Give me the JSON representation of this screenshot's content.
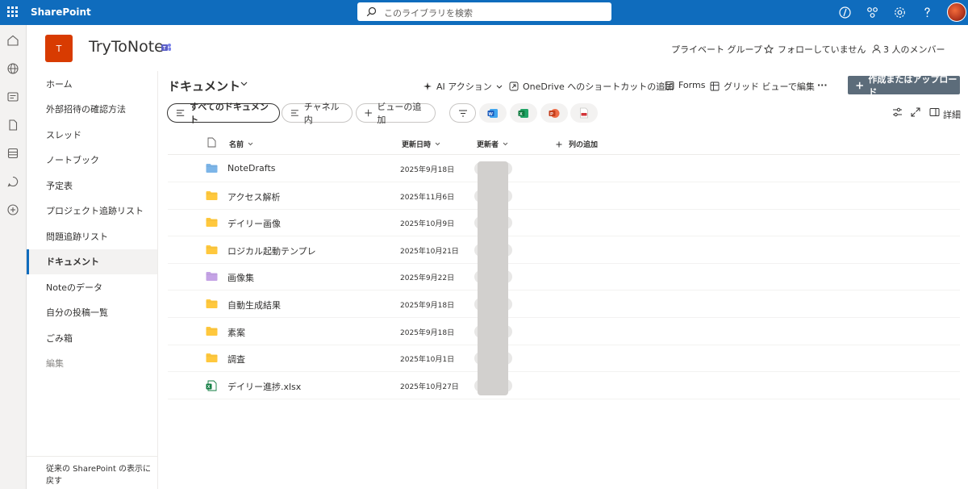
{
  "suite": {
    "app_name": "SharePoint",
    "search_placeholder": "このライブラリを検索"
  },
  "site": {
    "logo_letter": "T",
    "title": "TryToNote",
    "privacy": "プライベート グループ",
    "follow": "フォローしていません",
    "members": "3 人のメンバー"
  },
  "nav": {
    "items": [
      {
        "label": "ホーム"
      },
      {
        "label": "外部招待の確認方法"
      },
      {
        "label": "スレッド"
      },
      {
        "label": "ノートブック"
      },
      {
        "label": "予定表"
      },
      {
        "label": "プロジェクト追跡リスト"
      },
      {
        "label": "問題追跡リスト"
      },
      {
        "label": "ドキュメント"
      },
      {
        "label": "Noteのデータ"
      },
      {
        "label": "自分の投稿一覧"
      },
      {
        "label": "ごみ箱"
      },
      {
        "label": "編集"
      }
    ],
    "footer": "従来の SharePoint の表示に戻す"
  },
  "library": {
    "title": "ドキュメント",
    "commands": {
      "ai": "AI アクション",
      "shortcut": "OneDrive へのショートカットの追加",
      "forms": "Forms",
      "grid": "グリッド ビューで編集",
      "more": "···",
      "create": "作成またはアップロード"
    },
    "views": {
      "all": "すべてのドキュメント",
      "channel": "チャネル内",
      "add_view": "ビューの追加"
    },
    "details": "詳細"
  },
  "grid": {
    "columns": {
      "name": "名前",
      "modified": "更新日時",
      "modified_by": "更新者",
      "add_column": "列の追加"
    },
    "rows": [
      {
        "name": "NoteDrafts",
        "date": "2025年9月18日",
        "type": "folder-blue"
      },
      {
        "name": "アクセス解析",
        "date": "2025年11月6日",
        "type": "folder"
      },
      {
        "name": "デイリー画像",
        "date": "2025年10月9日",
        "type": "folder"
      },
      {
        "name": "ロジカル起動テンプレ",
        "date": "2025年10月21日",
        "type": "folder"
      },
      {
        "name": "画像集",
        "date": "2025年9月22日",
        "type": "folder-purple"
      },
      {
        "name": "自動生成結果",
        "date": "2025年9月18日",
        "type": "folder"
      },
      {
        "name": "素案",
        "date": "2025年9月18日",
        "type": "folder"
      },
      {
        "name": "調査",
        "date": "2025年10月1日",
        "type": "folder"
      },
      {
        "name": "デイリー進捗.xlsx",
        "date": "2025年10月27日",
        "type": "excel"
      }
    ]
  },
  "colors": {
    "suite_bar": "#0f6cbd",
    "site_logo": "#d83b01",
    "folder": "#ffc83d",
    "folder_blue": "#7cb5e8",
    "folder_purple": "#c5a3e6",
    "excel": "#107c41",
    "create_button": "#5c6c7a"
  }
}
